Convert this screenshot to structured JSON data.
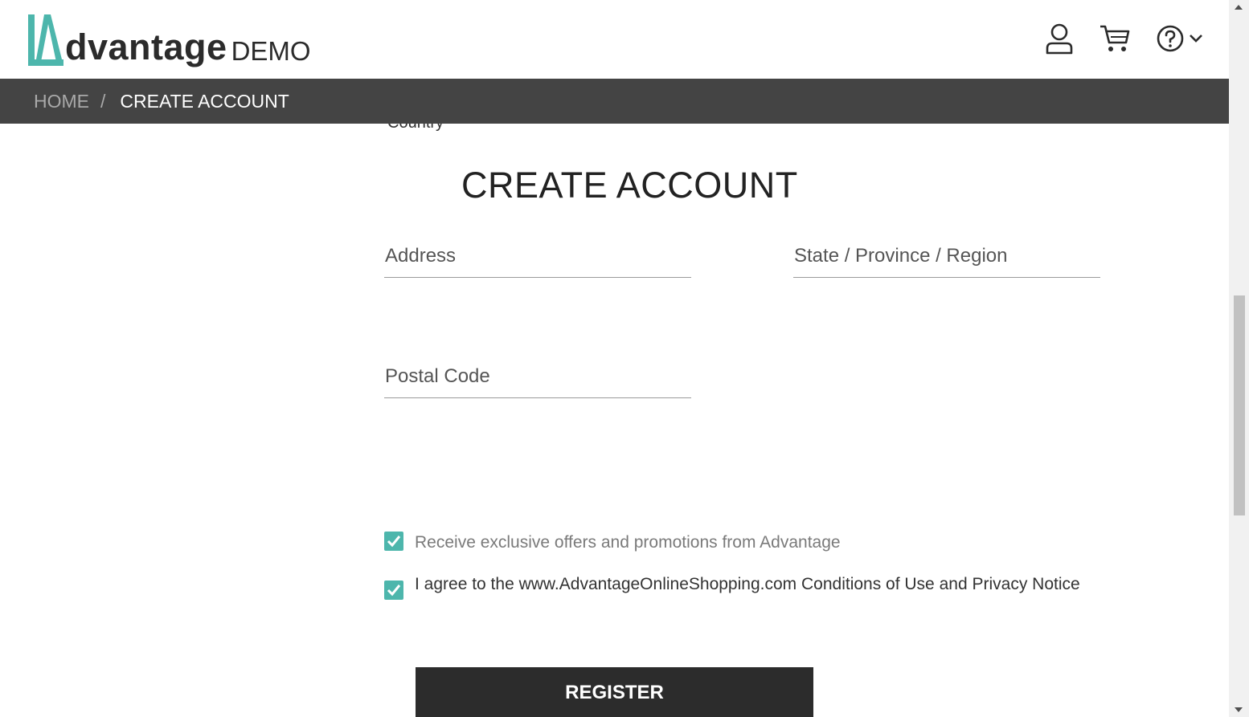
{
  "header": {
    "logo_text": "dvantage",
    "logo_demo": "DEMO",
    "icons": [
      "user-icon",
      "cart-icon",
      "help-icon",
      "chevron-down-icon"
    ]
  },
  "breadcrumb": {
    "home": "HOME",
    "separator": "/",
    "current": "CREATE ACCOUNT"
  },
  "partial_text": "Country",
  "form": {
    "title": "CREATE ACCOUNT",
    "address_placeholder": "Address",
    "state_placeholder": "State / Province / Region",
    "postal_placeholder": "Postal Code",
    "offers_label": "Receive exclusive offers and promotions from Advantage",
    "offers_checked": true,
    "agree_prefix": "I agree to the www.AdvantageOnlineShopping.com ",
    "agree_conditions": "Conditions of Use",
    "agree_and": " and ",
    "agree_privacy": "Privacy Notice",
    "agree_checked": true,
    "register_label": "REGISTER"
  },
  "colors": {
    "brand_teal": "#4db6ac",
    "breadcrumb_bg": "#444444",
    "button_bg": "#2c2c2c"
  }
}
